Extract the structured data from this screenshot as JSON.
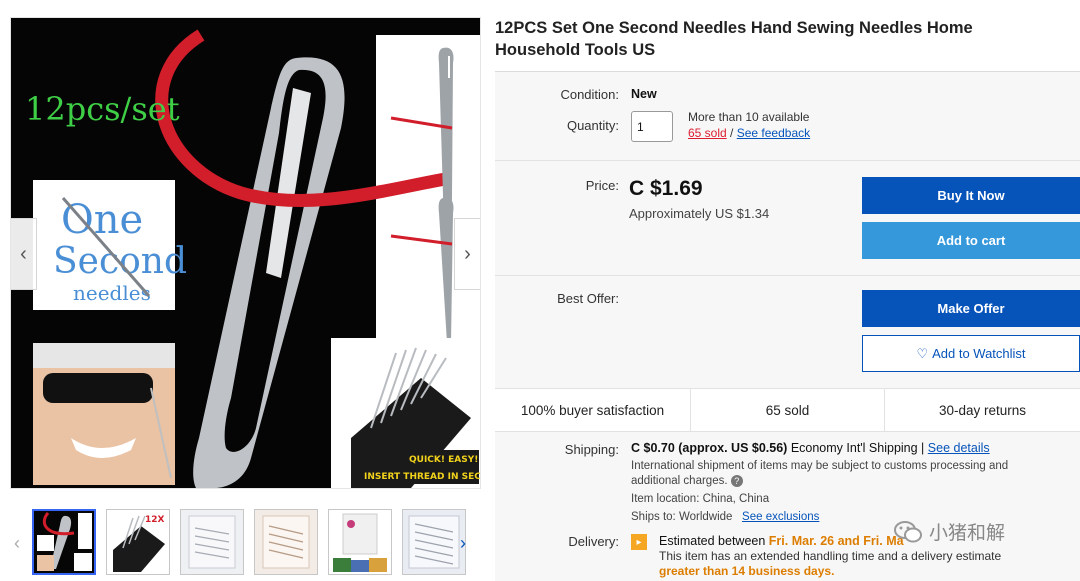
{
  "gallery": {
    "overlay_text": "12pcs/set",
    "logo_line1": "One",
    "logo_line2": "Second",
    "logo_line3": "needles",
    "banner_line1": "QUICK! EASY! JOB",
    "banner_line2": "INSERT THREAD IN SECOND",
    "thumb_badge": "12X"
  },
  "product": {
    "title": "12PCS Set One Second Needles Hand Sewing Needles Home Household Tools US"
  },
  "details": {
    "condition_label": "Condition:",
    "condition_value": "New",
    "quantity_label": "Quantity:",
    "quantity_value": "1",
    "availability": "More than 10 available",
    "sold_link": "65 sold",
    "separator": "/",
    "feedback_link": "See feedback"
  },
  "pricing": {
    "price_label": "Price:",
    "price": "C $1.69",
    "approx": "Approximately US $1.34",
    "buy_now": "Buy It Now",
    "add_to_cart": "Add to cart",
    "best_offer_label": "Best Offer:",
    "make_offer": "Make Offer",
    "watchlist": "Add to Watchlist"
  },
  "stats": {
    "satisfaction": "100% buyer satisfaction",
    "sold": "65 sold",
    "returns": "30-day returns"
  },
  "shipping": {
    "label": "Shipping:",
    "cost": "C $0.70 (approx. US $0.56)",
    "method": "Economy Int'l Shipping |",
    "details_link": "See details",
    "customs_line1": "International shipment of items may be subject to customs processing and",
    "customs_line2": "additional charges.",
    "location_label": "Item location:",
    "location_value": "China, China",
    "ships_to_label": "Ships to:",
    "ships_to_value": "Worldwide",
    "exclusions_link": "See exclusions"
  },
  "delivery": {
    "label": "Delivery:",
    "estimate_prefix": "Estimated between",
    "estimate_dates": "Fri. Mar. 26 and Fri. Ma",
    "handling_line": "This item has an extended handling time and a delivery estimate",
    "handling_emph": "greater than 14 business days."
  },
  "watermark": {
    "text": "小猪和解"
  },
  "colors": {
    "primary_blue": "#0654ba",
    "cart_blue": "#3498db",
    "alert_red": "#dd1e31",
    "orange": "#dd7d00"
  }
}
